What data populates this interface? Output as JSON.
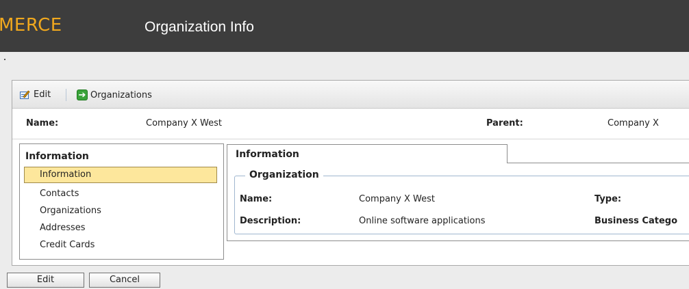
{
  "header": {
    "brand": "MERCE",
    "title": "Organization Info"
  },
  "toolbar": {
    "edit_label": "Edit",
    "organizations_label": "Organizations"
  },
  "summary": {
    "name_label": "Name:",
    "name_value": "Company X West",
    "parent_label": "Parent:",
    "parent_value": "Company X"
  },
  "nav": {
    "header": "Information",
    "items": [
      {
        "label": "Information"
      },
      {
        "label": "Contacts"
      },
      {
        "label": "Organizations"
      },
      {
        "label": "Addresses"
      },
      {
        "label": "Credit Cards"
      }
    ],
    "selected": "Information"
  },
  "tab": {
    "label": "Information"
  },
  "organization": {
    "legend": "Organization",
    "name_label": "Name:",
    "name_value": "Company X West",
    "type_label": "Type:",
    "description_label": "Description:",
    "description_value": "Online software applications",
    "business_category_label": "Business Catego"
  },
  "actions": {
    "edit_label": "Edit",
    "cancel_label": "Cancel"
  },
  "colors": {
    "topbar": "#3d3d3d",
    "brand": "#f0a81e",
    "selected_row": "#fde79c"
  },
  "icons": {
    "edit": "edit-document-icon",
    "organizations": "green-arrow-icon"
  }
}
